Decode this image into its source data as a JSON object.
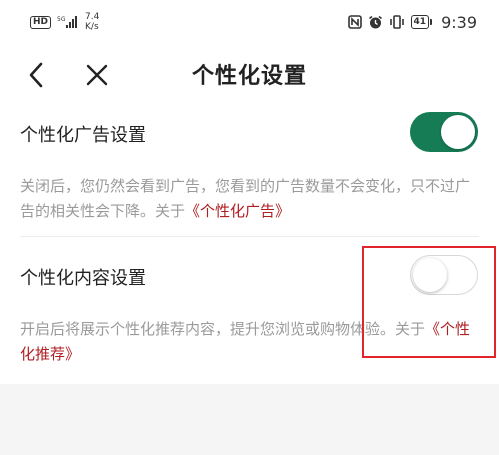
{
  "status_bar": {
    "hd_label": "HD",
    "network_speed_value": "7.4",
    "network_speed_unit": "K/s",
    "battery_level": "41",
    "time": "9:39",
    "icons": [
      "signal-icon",
      "nfc-icon",
      "alarm-icon",
      "vibrate-icon",
      "battery-icon"
    ]
  },
  "nav": {
    "title": "个性化设置",
    "back_icon": "chevron-left-icon",
    "close_icon": "close-icon"
  },
  "settings": [
    {
      "label": "个性化广告设置",
      "enabled": true,
      "description": "关闭后，您仍然会看到广告，您看到的广告数量不会变化，只不过广告的相关性会下降。关于",
      "link_text": "《个性化广告》"
    },
    {
      "label": "个性化内容设置",
      "enabled": false,
      "description": "开启后将展示个性化推荐内容，提升您浏览或购物体验。关于",
      "link_text": "《个性化推荐》"
    }
  ],
  "colors": {
    "toggle_on": "#157c56",
    "link": "#b01e22",
    "description": "#9a9a9a",
    "highlight_box": "#e0262b"
  }
}
